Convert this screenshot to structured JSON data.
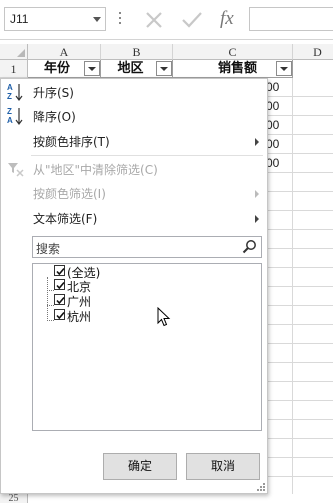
{
  "formula_bar": {
    "name_box": "J11",
    "fx_label": "fx"
  },
  "sheet": {
    "columns": [
      "A",
      "B",
      "C",
      "D"
    ],
    "row_numbers": [
      "1",
      "25"
    ],
    "header_cells": [
      "年份",
      "地区",
      "销售额"
    ],
    "visible_values": [
      "00",
      "00",
      "00",
      "00",
      "00"
    ]
  },
  "filter_menu": {
    "items": [
      {
        "label": "升序(S)",
        "icon": "sort-ascending-icon",
        "enabled": true
      },
      {
        "label": "降序(O)",
        "icon": "sort-descending-icon",
        "enabled": true
      },
      {
        "label": "按颜色排序(T)",
        "enabled": true,
        "submenu": true
      },
      {
        "label": "从\"地区\"中清除筛选(C)",
        "icon": "clear-filter-icon",
        "enabled": false
      },
      {
        "label": "按颜色筛选(I)",
        "enabled": false,
        "submenu": true
      },
      {
        "label": "文本筛选(F)",
        "enabled": true,
        "submenu": true
      }
    ],
    "search_placeholder": "搜索",
    "checklist": [
      {
        "label": "(全选)",
        "checked": true
      },
      {
        "label": "北京",
        "checked": true
      },
      {
        "label": "广州",
        "checked": true
      },
      {
        "label": "杭州",
        "checked": true
      }
    ],
    "ok_label": "确定",
    "cancel_label": "取消"
  }
}
